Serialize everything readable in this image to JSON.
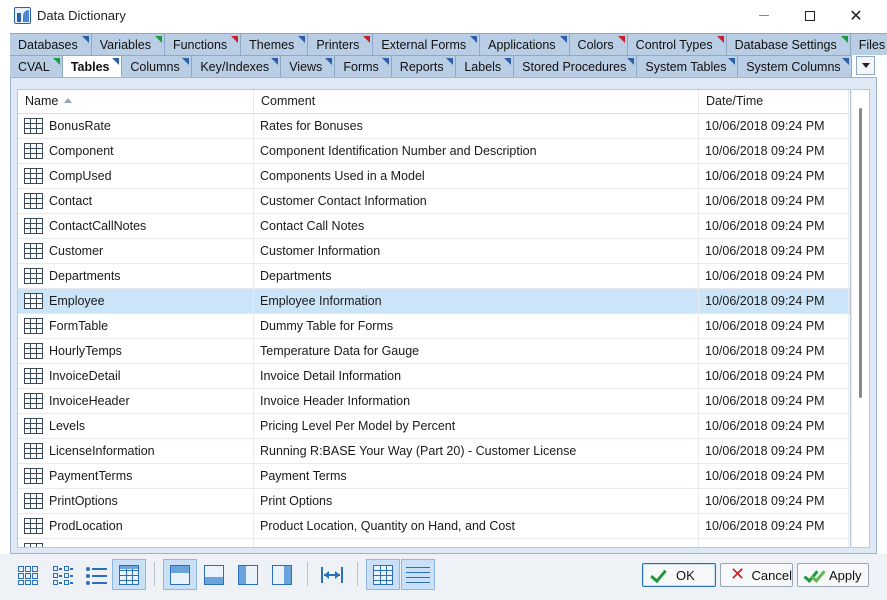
{
  "window": {
    "title": "Data Dictionary"
  },
  "tabs_row1": [
    {
      "label": "Databases",
      "flag": "blue"
    },
    {
      "label": "Variables",
      "flag": "green"
    },
    {
      "label": "Functions",
      "flag": "red"
    },
    {
      "label": "Themes",
      "flag": "blue"
    },
    {
      "label": "Printers",
      "flag": "red"
    },
    {
      "label": "External Forms",
      "flag": "blue"
    },
    {
      "label": "Applications",
      "flag": "blue"
    },
    {
      "label": "Colors",
      "flag": "red"
    },
    {
      "label": "Control Types",
      "flag": "red"
    },
    {
      "label": "Database Settings",
      "flag": "green"
    },
    {
      "label": "Files",
      "flag": "blue"
    }
  ],
  "tabs_row2": [
    {
      "label": "CVAL",
      "flag": "green",
      "active": false
    },
    {
      "label": "Tables",
      "flag": "blue",
      "active": true
    },
    {
      "label": "Columns",
      "flag": "blue",
      "active": false
    },
    {
      "label": "Key/Indexes",
      "flag": "blue",
      "active": false
    },
    {
      "label": "Views",
      "flag": "blue",
      "active": false
    },
    {
      "label": "Forms",
      "flag": "blue",
      "active": false
    },
    {
      "label": "Reports",
      "flag": "blue",
      "active": false
    },
    {
      "label": "Labels",
      "flag": "blue",
      "active": false
    },
    {
      "label": "Stored Procedures",
      "flag": "blue",
      "active": false
    },
    {
      "label": "System Tables",
      "flag": "blue",
      "active": false
    },
    {
      "label": "System Columns",
      "flag": "blue",
      "active": false
    }
  ],
  "grid": {
    "columns": [
      "Name",
      "Comment",
      "Date/Time"
    ],
    "selected_row": 7,
    "rows": [
      {
        "name": "BonusRate",
        "comment": "Rates for Bonuses",
        "datetime": "10/06/2018 09:24 PM"
      },
      {
        "name": "Component",
        "comment": "Component Identification Number and Description",
        "datetime": "10/06/2018 09:24 PM"
      },
      {
        "name": "CompUsed",
        "comment": "Components Used in a Model",
        "datetime": "10/06/2018 09:24 PM"
      },
      {
        "name": "Contact",
        "comment": "Customer Contact Information",
        "datetime": "10/06/2018 09:24 PM"
      },
      {
        "name": "ContactCallNotes",
        "comment": "Contact Call Notes",
        "datetime": "10/06/2018 09:24 PM"
      },
      {
        "name": "Customer",
        "comment": "Customer Information",
        "datetime": "10/06/2018 09:24 PM"
      },
      {
        "name": "Departments",
        "comment": "Departments",
        "datetime": "10/06/2018 09:24 PM"
      },
      {
        "name": "Employee",
        "comment": "Employee Information",
        "datetime": "10/06/2018 09:24 PM"
      },
      {
        "name": "FormTable",
        "comment": "Dummy Table for Forms",
        "datetime": "10/06/2018 09:24 PM"
      },
      {
        "name": "HourlyTemps",
        "comment": "Temperature Data for Gauge",
        "datetime": "10/06/2018 09:24 PM"
      },
      {
        "name": "InvoiceDetail",
        "comment": "Invoice Detail Information",
        "datetime": "10/06/2018 09:24 PM"
      },
      {
        "name": "InvoiceHeader",
        "comment": "Invoice Header Information",
        "datetime": "10/06/2018 09:24 PM"
      },
      {
        "name": "Levels",
        "comment": "Pricing Level Per Model by Percent",
        "datetime": "10/06/2018 09:24 PM"
      },
      {
        "name": "LicenseInformation",
        "comment": "Running R:BASE Your Way (Part 20) - Customer License",
        "datetime": "10/06/2018 09:24 PM"
      },
      {
        "name": "PaymentTerms",
        "comment": "Payment Terms",
        "datetime": "10/06/2018 09:24 PM"
      },
      {
        "name": "PrintOptions",
        "comment": "Print Options",
        "datetime": "10/06/2018 09:24 PM"
      },
      {
        "name": "ProdLocation",
        "comment": "Product Location, Quantity on Hand, and Cost",
        "datetime": "10/06/2018 09:24 PM"
      },
      {
        "name": "",
        "comment": "",
        "datetime": ""
      }
    ]
  },
  "buttons": {
    "ok": "OK",
    "cancel": "Cancel",
    "apply": "Apply"
  },
  "icons": {
    "app": "data-dictionary-icon",
    "toolbar": [
      "large-icons-view-icon",
      "small-icons-view-icon",
      "list-view-icon",
      "details-view-icon",
      "layout-top-icon",
      "layout-bottom-icon",
      "layout-left-icon",
      "layout-right-icon",
      "auto-size-columns-icon",
      "show-grid-lines-icon",
      "row-lines-icon"
    ]
  },
  "colors": {
    "selected_row": "#cce4f7",
    "tab_background": "#b9cde4",
    "accent": "#2d6fb8"
  }
}
